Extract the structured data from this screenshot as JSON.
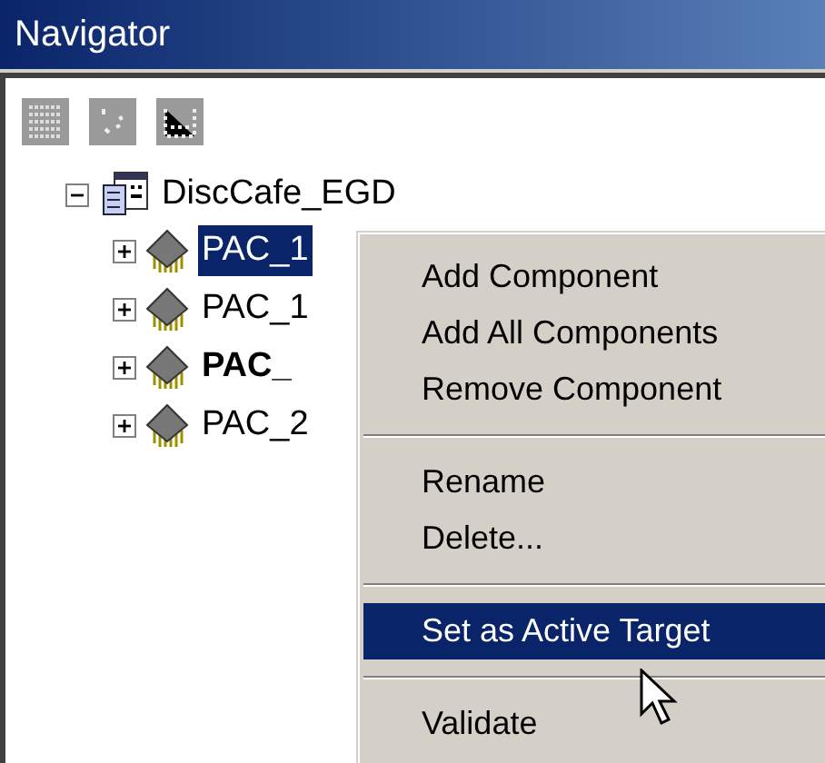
{
  "window": {
    "title": "Navigator"
  },
  "tree": {
    "label": "DiscCafe_EGD",
    "expanded": true,
    "children": [
      {
        "label": "PAC_1",
        "selected": true,
        "bold": false,
        "expanded": false
      },
      {
        "label": "PAC_1",
        "selected": false,
        "bold": false,
        "expanded": false
      },
      {
        "label": "PAC_",
        "selected": false,
        "bold": true,
        "expanded": false
      },
      {
        "label": "PAC_2",
        "selected": false,
        "bold": false,
        "expanded": false
      }
    ]
  },
  "context_menu": {
    "items": [
      {
        "kind": "item",
        "label": "Add Component",
        "selected": false
      },
      {
        "kind": "item",
        "label": "Add All Components",
        "selected": false
      },
      {
        "kind": "item",
        "label": "Remove Component",
        "selected": false
      },
      {
        "kind": "separator"
      },
      {
        "kind": "item",
        "label": "Rename",
        "selected": false
      },
      {
        "kind": "item",
        "label": "Delete...",
        "selected": false
      },
      {
        "kind": "separator"
      },
      {
        "kind": "item",
        "label": "Set as Active Target",
        "selected": true
      },
      {
        "kind": "separator"
      },
      {
        "kind": "item",
        "label": "Validate",
        "selected": false
      }
    ]
  }
}
